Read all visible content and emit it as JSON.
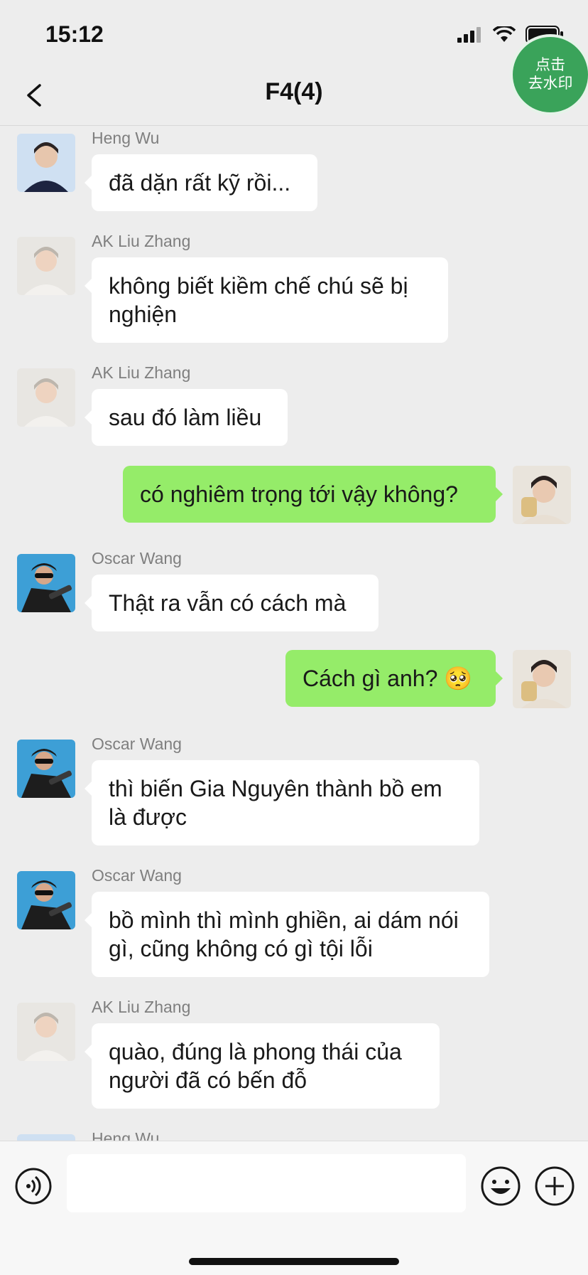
{
  "status_bar": {
    "time": "15:12"
  },
  "header": {
    "title": "F4(4)"
  },
  "watermark_badge": {
    "line1": "点击",
    "line2": "去水印"
  },
  "messages": [
    {
      "side": "in",
      "sender": "Heng Wu",
      "text": "đã dặn rất kỹ rồi..."
    },
    {
      "side": "in",
      "sender": "AK Liu Zhang",
      "text": "không biết kiềm chế chú sẽ bị nghiện"
    },
    {
      "side": "in",
      "sender": "AK Liu Zhang",
      "text": "sau đó làm liều"
    },
    {
      "side": "out",
      "sender": "",
      "text": "có nghiêm trọng tới vậy không?"
    },
    {
      "side": "in",
      "sender": "Oscar Wang",
      "text": "Thật ra vẫn có cách mà"
    },
    {
      "side": "out",
      "sender": "",
      "text": "Cách gì anh? 🥺"
    },
    {
      "side": "in",
      "sender": "Oscar Wang",
      "text": "thì biến Gia Nguyên thành bồ em là được"
    },
    {
      "side": "in",
      "sender": "Oscar Wang",
      "text": "bồ mình thì mình ghiền, ai dám nói gì, cũng không có gì tội lỗi"
    },
    {
      "side": "in",
      "sender": "AK Liu Zhang",
      "text": "quào, đúng là phong thái của người đã có bến đỗ"
    },
    {
      "side": "in",
      "sender": "Heng Wu",
      "text": ""
    }
  ],
  "input_bar": {
    "voice_icon": "voice-icon",
    "emoji_icon": "emoji-icon",
    "plus_icon": "plus-icon",
    "text_value": ""
  },
  "colors": {
    "background": "#ededed",
    "outgoing_bubble": "#95ec69",
    "incoming_bubble": "#ffffff",
    "watermark_badge": "#3aa35a"
  }
}
